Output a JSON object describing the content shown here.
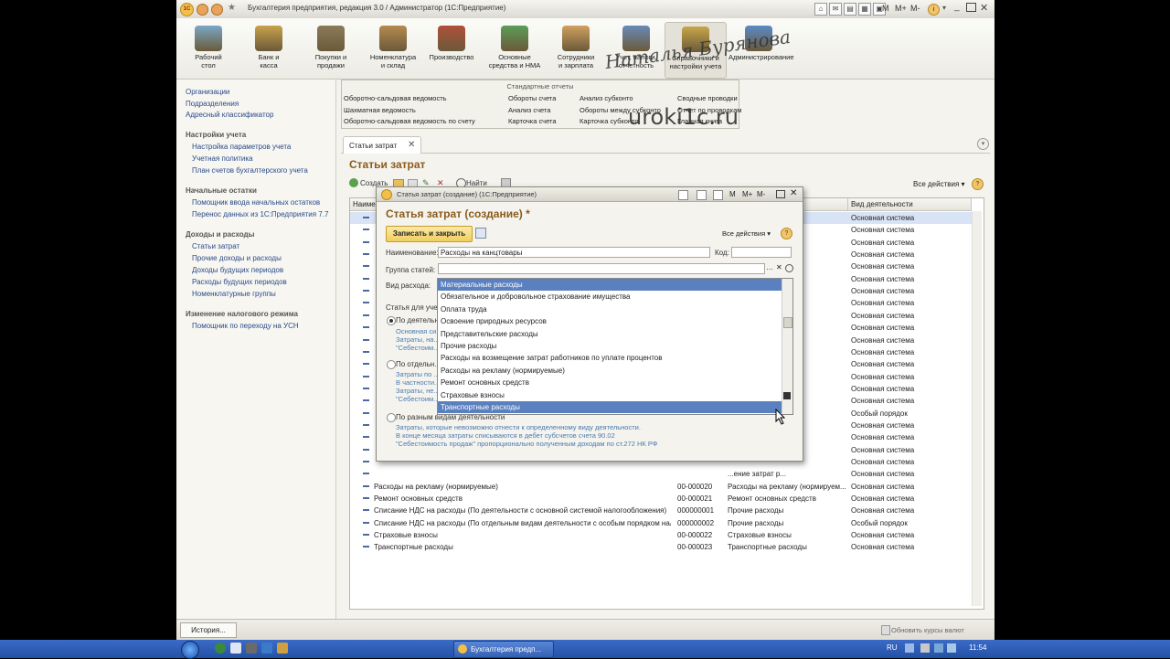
{
  "window": {
    "title": "Бухгалтерия предприятия, редакция 3.0 / Администратор (1С:Предприятие)",
    "m_buttons": [
      "M",
      "M+",
      "M-"
    ]
  },
  "ribbon": [
    {
      "label": "Рабочий\nстол",
      "color": "#7aa8c6"
    },
    {
      "label": "Банк и\nкасса",
      "color": "#c9a24a"
    },
    {
      "label": "Покупки и\nпродажи",
      "color": "#8b7b5a"
    },
    {
      "label": "Номенклатура\nи склад",
      "color": "#b58a4e"
    },
    {
      "label": "Производство",
      "color": "#b0503a"
    },
    {
      "label": "Основные\nсредства и НМА",
      "color": "#5c9c58"
    },
    {
      "label": "Сотрудники\nи зарплата",
      "color": "#d0a060"
    },
    {
      "label": "Учет, налоги,\nотчетность",
      "color": "#6a8ab8"
    },
    {
      "label": "Справочники и\nнастройки учета",
      "color": "#c8a648"
    },
    {
      "label": "Администрирование",
      "color": "#5a8ac8"
    }
  ],
  "watermark": {
    "name": "Наталья Бурянова",
    "site": "uroki1c.ru"
  },
  "left_panel": {
    "top_links": [
      "Организации",
      "Подразделения",
      "Адресный классификатор"
    ],
    "groups": [
      {
        "title": "Настройки учета",
        "items": [
          "Настройка параметров учета",
          "Учетная политика",
          "План счетов бухгалтерского учета"
        ]
      },
      {
        "title": "Начальные остатки",
        "items": [
          "Помощник ввода начальных остатков",
          "Перенос данных из 1С:Предприятия 7.7"
        ]
      },
      {
        "title": "Доходы и расходы",
        "items": [
          "Статьи затрат",
          "Прочие доходы и расходы",
          "Доходы будущих периодов",
          "Расходы будущих периодов",
          "Номенклатурные группы"
        ]
      },
      {
        "title": "Изменение налогового режима",
        "items": [
          "Помощник по переходу на УСН"
        ]
      }
    ]
  },
  "std_reports": {
    "title": "Стандартные отчеты",
    "columns": [
      [
        "Оборотно-сальдовая ведомость",
        "Шахматная ведомость",
        "Оборотно-сальдовая ведомость по счету"
      ],
      [
        "Обороты счета",
        "Анализ счета",
        "Карточка счета"
      ],
      [
        "Анализ субконто",
        "Обороты между субконто",
        "Карточка субконто"
      ],
      [
        "Сводные проводки",
        "Отчет по проводкам",
        "Главная книга"
      ]
    ]
  },
  "tab": {
    "label": "Статьи затрат",
    "close": "✕"
  },
  "page": {
    "title": "Статьи затрат",
    "all_actions": "Все действия ▾",
    "help": "?"
  },
  "toolbar": {
    "create": "Создать",
    "find": "Найти"
  },
  "grid": {
    "headers": [
      "Наиме...",
      "Код",
      "Вид расхода",
      "Вид деятельности"
    ],
    "rows": [
      {
        "name": "",
        "code": "",
        "kind": "...ия",
        "act": "Основная система",
        "hl": true
      },
      {
        "name": "",
        "code": "",
        "kind": "",
        "act": "Основная система"
      },
      {
        "name": "",
        "code": "",
        "kind": "...и муниципа...",
        "act": "Основная система"
      },
      {
        "name": "",
        "code": "",
        "kind": "",
        "act": "Основная система"
      },
      {
        "name": "",
        "code": "",
        "kind": "...страховани...",
        "act": "Основная система"
      },
      {
        "name": "",
        "code": "",
        "kind": "...страховани...",
        "act": "Основная система"
      },
      {
        "name": "",
        "code": "",
        "kind": "...ряне по д...",
        "act": "Основная система"
      },
      {
        "name": "",
        "code": "",
        "kind": "",
        "act": "Основная система"
      },
      {
        "name": "",
        "code": "",
        "kind": "...ов",
        "act": "Основная система"
      },
      {
        "name": "",
        "code": "",
        "kind": "...ы",
        "act": "Основная система"
      },
      {
        "name": "",
        "code": "",
        "kind": "",
        "act": "Основная система"
      },
      {
        "name": "",
        "code": "",
        "kind": "...ях налого...",
        "act": "Основная система"
      },
      {
        "name": "",
        "code": "",
        "kind": "",
        "act": "Основная система"
      },
      {
        "name": "",
        "code": "",
        "kind": "...ительст...",
        "act": "Основная система"
      },
      {
        "name": "",
        "code": "",
        "kind": "...ние",
        "act": "Основная система"
      },
      {
        "name": "",
        "code": "",
        "kind": "",
        "act": "Основная система"
      },
      {
        "name": "",
        "code": "",
        "kind": "",
        "act": "Особый порядок"
      },
      {
        "name": "",
        "code": "",
        "kind": "",
        "act": "Основная система"
      },
      {
        "name": "",
        "code": "",
        "kind": "...ресурсов",
        "act": "Основная система"
      },
      {
        "name": "",
        "code": "",
        "kind": "...ходы",
        "act": "Основная система"
      },
      {
        "name": "",
        "code": "",
        "kind": "",
        "act": "Основная система"
      },
      {
        "name": "",
        "code": "",
        "kind": "...ение затрат р...",
        "act": "Основная система"
      },
      {
        "name": "Расходы на рекламу (нормируемые)",
        "code": "00-000020",
        "kind": "Расходы на рекламу (нормируем...",
        "act": "Основная система"
      },
      {
        "name": "Ремонт основных средств",
        "code": "00-000021",
        "kind": "Ремонт основных средств",
        "act": "Основная система"
      },
      {
        "name": "Списание НДС на расходы (По деятельности с основной системой налогообложения)",
        "code": "000000001",
        "kind": "Прочие расходы",
        "act": "Основная система"
      },
      {
        "name": "Списание НДС на расходы (По отдельным видам деятельности с особым порядком налогообложения)",
        "code": "000000002",
        "kind": "Прочие расходы",
        "act": "Особый порядок"
      },
      {
        "name": "Страховые взносы",
        "code": "00-000022",
        "kind": "Страховые взносы",
        "act": "Основная система"
      },
      {
        "name": "Транспортные расходы",
        "code": "00-000023",
        "kind": "Транспортные расходы",
        "act": "Основная система"
      }
    ]
  },
  "dialog": {
    "window_title": "Статья затрат (создание) (1С:Предприятие)",
    "heading": "Статья затрат (создание) *",
    "save_close": "Записать и закрыть",
    "all_actions": "Все действия ▾",
    "help": "?",
    "name_label": "Наименование:",
    "name_value": "Расходы на канцтовары",
    "code_label": "Код:",
    "code_value": "",
    "group_label": "Группа статей:",
    "group_value": "",
    "kind_label": "Вид расхода:",
    "kind_value": "Материальные расходы",
    "article_label": "Статья для учет...",
    "radio1": "По деятельн...",
    "radio1_hint": [
      "Основная си...",
      "Затраты, на...",
      "\"Себестоим..."
    ],
    "radio2": "По отдельн...",
    "radio2_hint": [
      "Затраты по ...",
      "В частности...",
      "Затраты, не...",
      "\"Себестоим..."
    ],
    "radio3": "По разным видам деятельности",
    "radio3_hint": [
      "Затраты, которые невозможно отнести к определенному виду деятельности.",
      "В конце месяца затраты списываются в дебет субсчетов счета 90.02",
      "\"Себестоимость продаж\" пропорционально полученным доходам по ст.272 НК РФ"
    ]
  },
  "dropdown": {
    "items": [
      "Материальные расходы",
      "Обязательное и добровольное страхование имущества",
      "Оплата труда",
      "Освоение природных ресурсов",
      "Представительские расходы",
      "Прочие расходы",
      "Расходы на возмещение затрат работников по уплате процентов",
      "Расходы на рекламу (нормируемые)",
      "Ремонт основных средств",
      "Страховые взносы",
      "Транспортные расходы"
    ],
    "selected": 0,
    "hovered": 10
  },
  "status": {
    "history": "История...",
    "rates": "Обновить курсы валют"
  },
  "taskbar": {
    "app": "Бухгалтерия предп...",
    "lang": "RU",
    "clock": "11:54"
  }
}
